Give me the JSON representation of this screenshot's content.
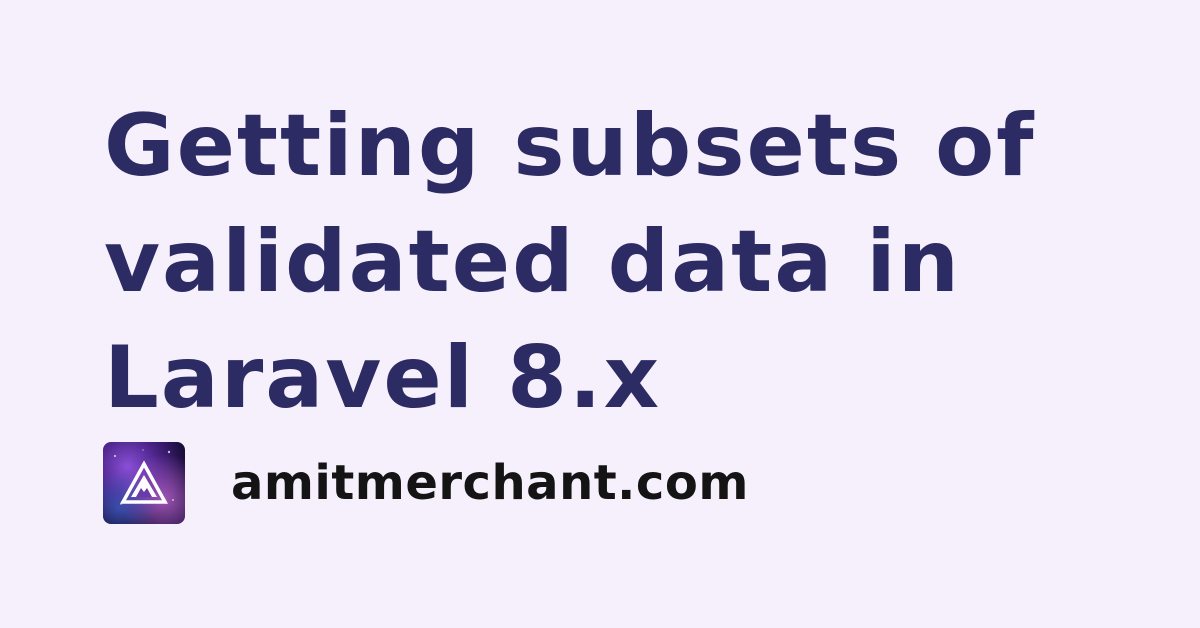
{
  "title": {
    "lines": [
      "Getting subsets of",
      "validated data in",
      "Laravel 8.x"
    ]
  },
  "brand": {
    "logo_icon": "mountain-triangle-icon",
    "site_name": "amitmerchant.com"
  },
  "colors": {
    "background": "#f6f0fd",
    "title": "#2d2b63",
    "site_name": "#141414"
  }
}
